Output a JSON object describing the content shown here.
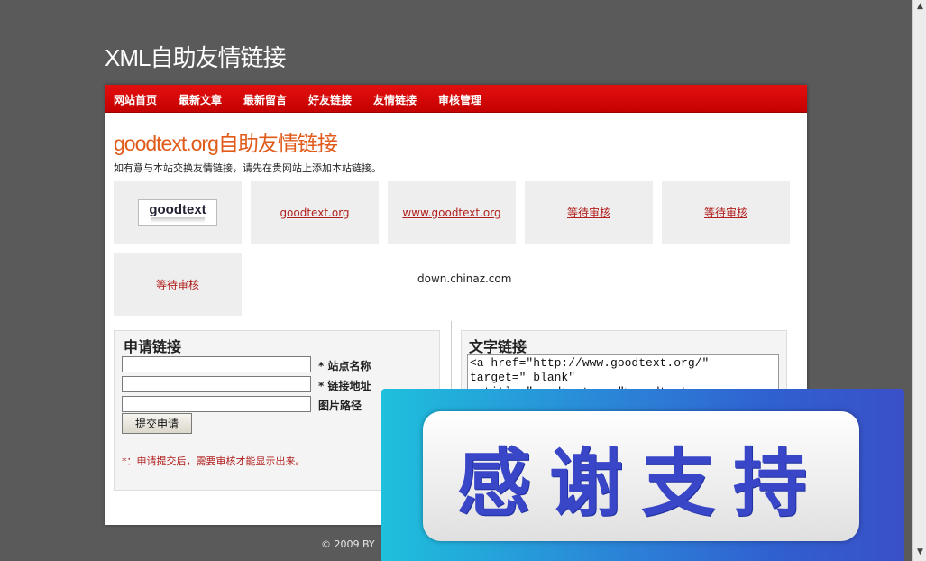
{
  "site_title": "XML自助友情链接",
  "nav": [
    {
      "label": "网站首页"
    },
    {
      "label": "最新文章"
    },
    {
      "label": "最新留言"
    },
    {
      "label": "好友链接"
    },
    {
      "label": "友情链接"
    },
    {
      "label": "审核管理"
    }
  ],
  "main": {
    "heading": "goodtext.org自助友情链接",
    "intro": "如有意与本站交换友情链接，请先在贵网站上添加本站链接。",
    "logo_text": "goodtext",
    "links": [
      {
        "label": "goodtext.org"
      },
      {
        "label": "www.goodtext.org"
      },
      {
        "label": "等待审核"
      },
      {
        "label": "等待审核"
      },
      {
        "label": "等待审核"
      }
    ],
    "domain_note": "down.chinaz.com"
  },
  "apply_form": {
    "title": "申请链接",
    "site_name_label": "* 站点名称",
    "site_url_label": "* 链接地址",
    "image_path_label": "图片路径",
    "submit_label": "提交申请",
    "note": "*：申请提交后，需要审核才能显示出来。"
  },
  "text_link": {
    "title": "文字链接",
    "code": "<a href=\"http://www.goodtext.org/\"\ntarget=\"_blank\"\n  title=\"goodtext.org\">goodtext"
  },
  "footer": "© 2009 BY",
  "overlay": {
    "text": "感谢支持"
  },
  "colors": {
    "background": "#5a5a5a",
    "nav": "#d80a0a",
    "heading": "#e05a1a",
    "link": "#b0201e",
    "overlay_text": "#3a46c8"
  }
}
